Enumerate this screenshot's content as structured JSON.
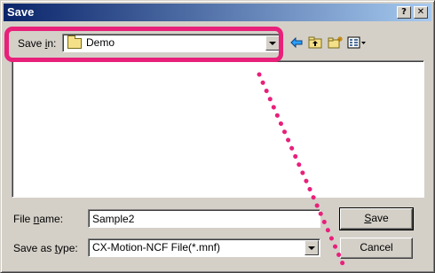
{
  "window": {
    "title": "Save",
    "help_glyph": "?",
    "close_glyph": "✕"
  },
  "toolbar": {
    "save_in_label_pre": "Save ",
    "save_in_label_key": "i",
    "save_in_label_post": "n:",
    "save_in_value": "Demo",
    "icons": [
      "back-arrow-icon",
      "up-one-level-icon",
      "create-new-folder-icon",
      "view-menu-icon"
    ]
  },
  "form": {
    "file_name_label_pre": "File ",
    "file_name_label_key": "n",
    "file_name_label_post": "ame:",
    "file_name_value": "Sample2",
    "save_as_type_label_pre": "Save as ",
    "save_as_type_label_key": "t",
    "save_as_type_label_post": "ype:",
    "save_as_type_value": "CX-Motion-NCF File(*.mnf)"
  },
  "buttons": {
    "save_key": "S",
    "save_rest": "ave",
    "cancel": "Cancel"
  },
  "colors": {
    "highlight": "#e8207a",
    "titlebar": "#0a246a"
  }
}
